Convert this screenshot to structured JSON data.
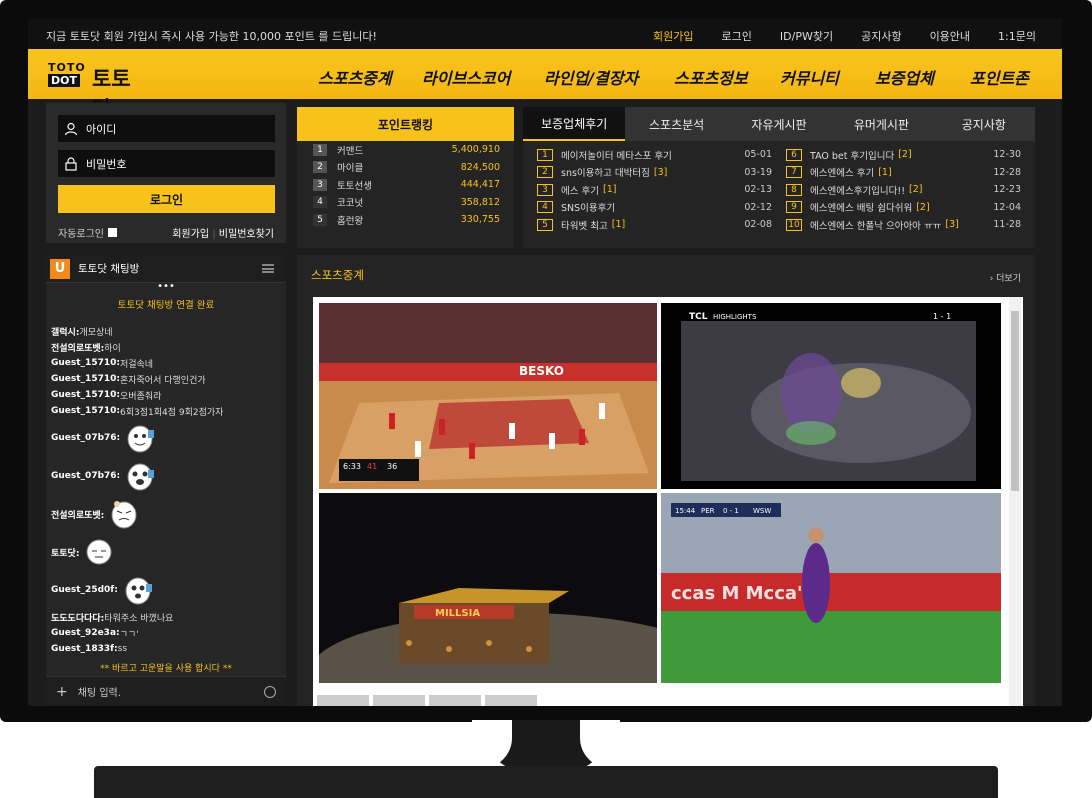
{
  "topbar": {
    "notice": "지금 토토닷 회원 가입시 즉시 사용 가능한 10,000 포인트 를 드립니다!",
    "links": [
      "회원가입",
      "로그인",
      "ID/PW찾기",
      "공지사항",
      "이용안내",
      "1:1문의"
    ]
  },
  "logo": {
    "line1": "TOTO",
    "line2": "DOT",
    "text": "토토닷"
  },
  "nav": [
    "스포츠중계",
    "라이브스코어",
    "라인업/결장자",
    "스포츠정보",
    "커뮤니티",
    "보증업체",
    "포인트존"
  ],
  "login": {
    "id_placeholder": "아이디",
    "pw_placeholder": "비밀번호",
    "button": "로그인",
    "auto_login": "자동로그인",
    "signup": "회원가입",
    "find_pw": "비밀번호찾기"
  },
  "point_ranking": {
    "title": "포인트랭킹",
    "rows": [
      {
        "rank": "1",
        "name": "커맨드",
        "points": "5,400,910"
      },
      {
        "rank": "2",
        "name": "마이클",
        "points": "824,500"
      },
      {
        "rank": "3",
        "name": "토토선생",
        "points": "444,417"
      },
      {
        "rank": "4",
        "name": "코코넛",
        "points": "358,812"
      },
      {
        "rank": "5",
        "name": "홈런왕",
        "points": "330,755"
      }
    ]
  },
  "board": {
    "tabs": [
      "보증업체후기",
      "스포츠분석",
      "자유게시판",
      "유머게시판",
      "공지사항"
    ],
    "left": [
      {
        "n": "1",
        "title": "메이저놀이터 메타스포 후기",
        "comments": "",
        "date": "05-01"
      },
      {
        "n": "2",
        "title": "sns이용하고 대박터짐",
        "comments": "[3]",
        "date": "03-19"
      },
      {
        "n": "3",
        "title": "에스 후기",
        "comments": "[1]",
        "date": "02-13"
      },
      {
        "n": "4",
        "title": "SNS이용후기",
        "comments": "",
        "date": "02-12"
      },
      {
        "n": "5",
        "title": "타워벳 최고",
        "comments": "[1]",
        "date": "02-08"
      }
    ],
    "right": [
      {
        "n": "6",
        "title": "TAO bet 후기입니다",
        "comments": "[2]",
        "date": "12-30"
      },
      {
        "n": "7",
        "title": "에스엔에스 후기",
        "comments": "[1]",
        "date": "12-28"
      },
      {
        "n": "8",
        "title": "에스엔에스후기입니다!!",
        "comments": "[2]",
        "date": "12-23"
      },
      {
        "n": "9",
        "title": "에스엔에스 배팅 쉽다쉬워",
        "comments": "[2]",
        "date": "12-04"
      },
      {
        "n": "10",
        "title": "에스엔에스 한폴낙 으아아아 ㅠㅠ",
        "comments": "[3]",
        "date": "11-28"
      }
    ]
  },
  "chat": {
    "title": "토토닷 채팅방",
    "dots": "•••",
    "system": "토토닷 채팅방 연결 완료",
    "messages": [
      {
        "user": "갤럭시:",
        "text": " 개모상네"
      },
      {
        "user": "전설의로또벳:",
        "text": " 하이"
      },
      {
        "user": "Guest_15710:",
        "text": " 저걸속네"
      },
      {
        "user": "Guest_15710:",
        "text": " 혼자죽어서 다행인건가"
      },
      {
        "user": "Guest_15710:",
        "text": " 오버좀줘라"
      },
      {
        "user": "Guest_15710:",
        "text": " 6회3점1회4점 9회2점가자"
      }
    ],
    "emoji_messages": [
      {
        "user": "Guest_07b76:"
      },
      {
        "user": "Guest_07b76:"
      },
      {
        "user": "전설의로또벳:"
      },
      {
        "user": "토토닷:"
      },
      {
        "user": "Guest_25d0f:"
      }
    ],
    "messages2": [
      {
        "user": "도도도다다다:",
        "text": " 타워주소 바꼈나요"
      },
      {
        "user": "Guest_92e3a:",
        "text": " ㄱㄱ'"
      },
      {
        "user": "Guest_1833f:",
        "text": " ss"
      }
    ],
    "warning": "** 바르고 고운말을 사용 합시다 **",
    "input_placeholder": "채팅 입력."
  },
  "sports": {
    "title": "스포츠중계",
    "more": "› 더보기",
    "videos": [
      {
        "name": "basketball",
        "sponsor": "BESKO",
        "score_a": "41",
        "score_b": "36",
        "clock": "6:33"
      },
      {
        "name": "esports",
        "brand": "TCL",
        "tag": "HIGHLIGHTS",
        "score": "1 - 1"
      },
      {
        "name": "baseball-stadium",
        "sign": "MILLSIA"
      },
      {
        "name": "soccer",
        "time": "15:44",
        "home": "PER",
        "away": "WSW",
        "score": "0 - 1"
      }
    ]
  },
  "colors": {
    "accent": "#f7c31a",
    "background": "#1c1c1c"
  }
}
